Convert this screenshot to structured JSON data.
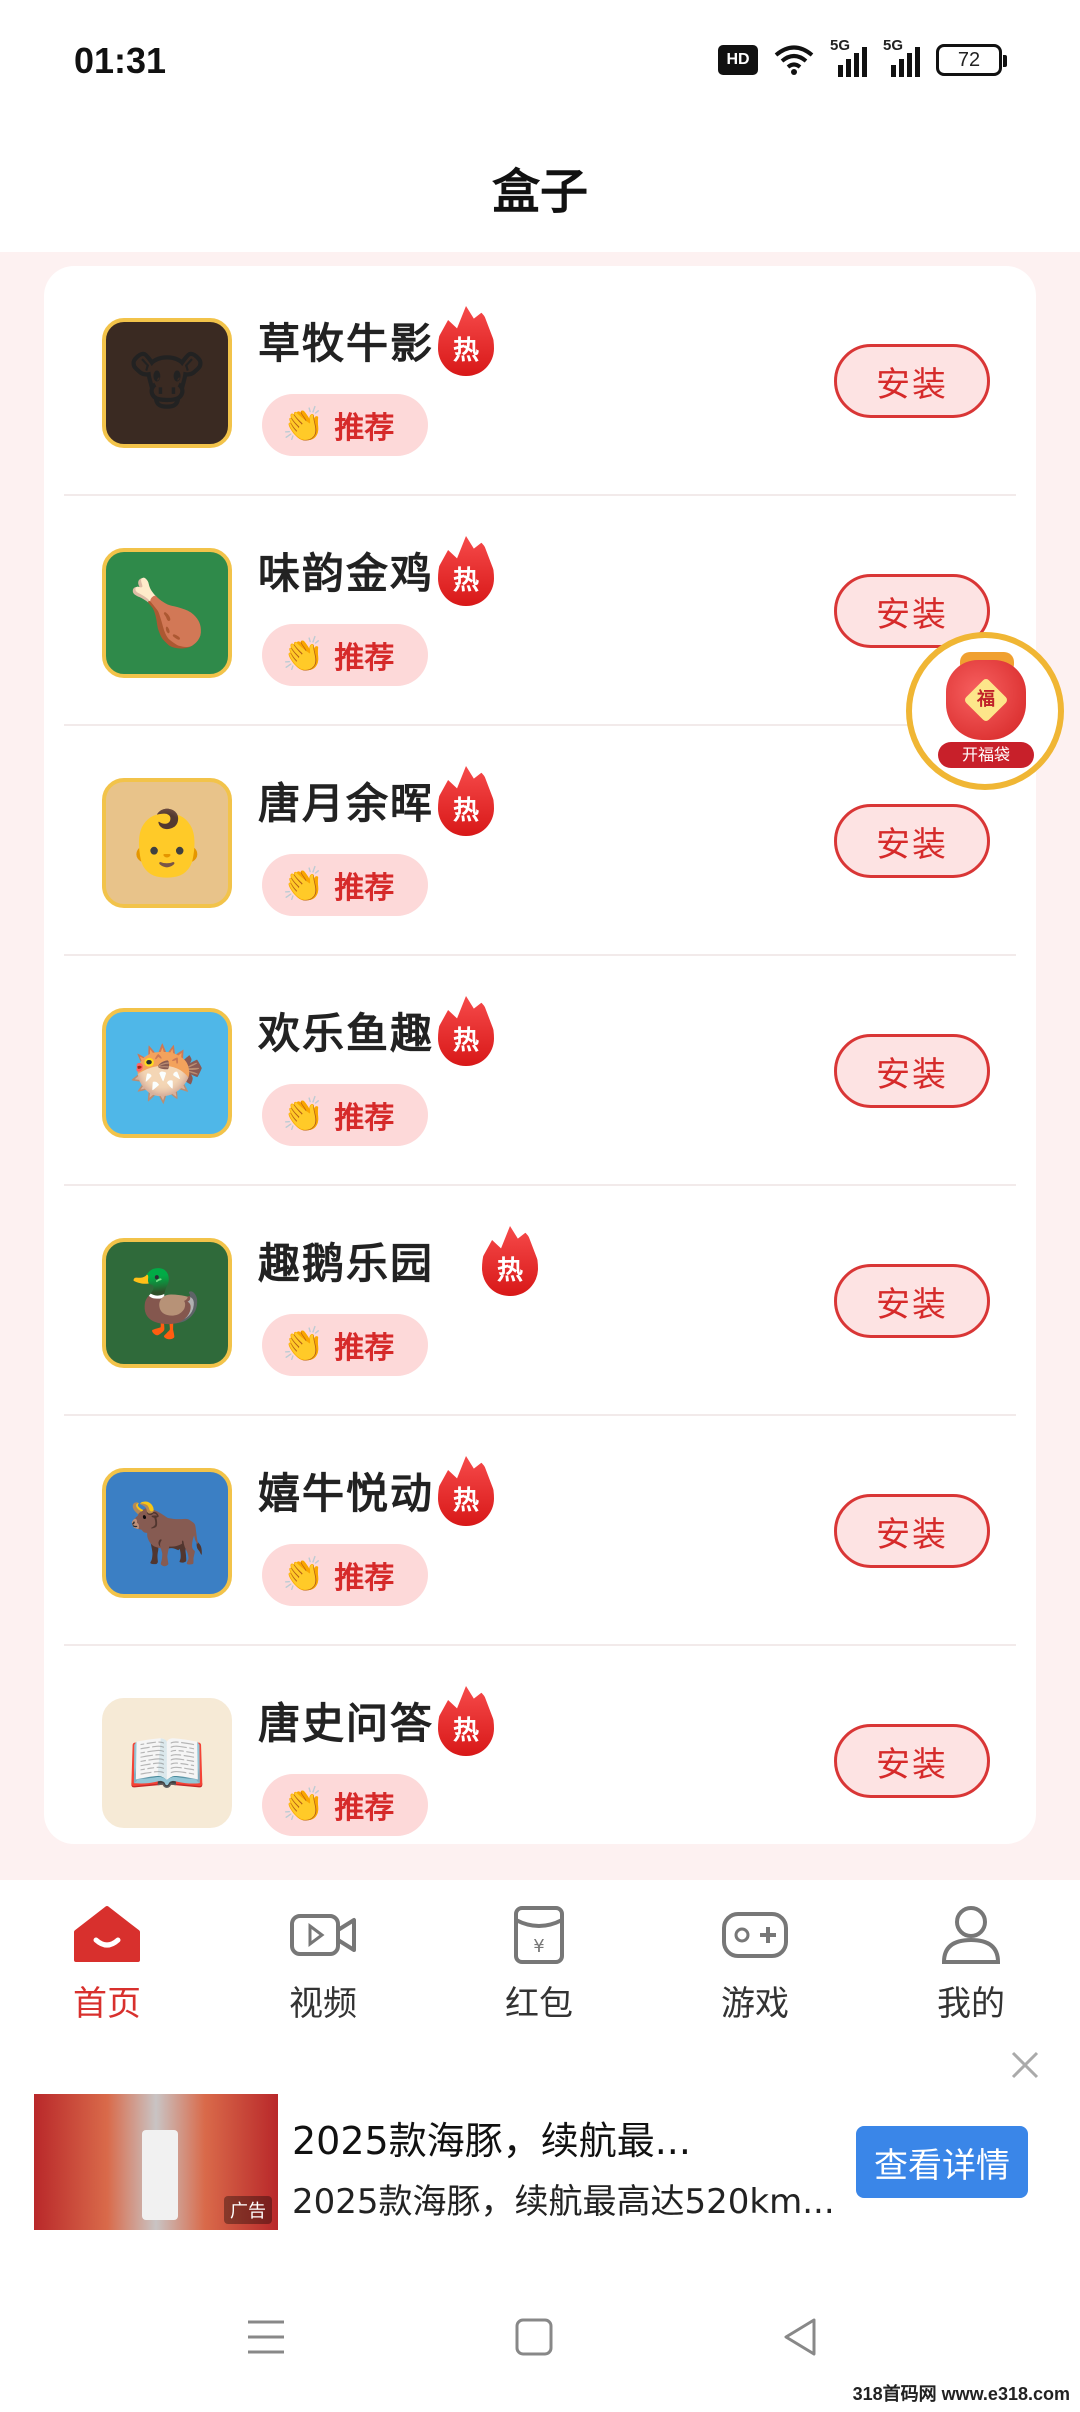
{
  "status_bar": {
    "time": "01:31",
    "hd": "HD",
    "signal1": "5G",
    "signal2": "5G",
    "battery": "72"
  },
  "header": {
    "title": "盒子"
  },
  "apps": [
    {
      "name": "草牧牛影",
      "hot": "热",
      "tag": "推荐",
      "install": "安装",
      "icon": "cow-icon",
      "icon_bg": "#3a2a22",
      "glyph": "🐮"
    },
    {
      "name": "味韵金鸡",
      "hot": "热",
      "tag": "推荐",
      "install": "安装",
      "icon": "roast-chicken-icon",
      "icon_bg": "#2f8a4a",
      "glyph": "🍗"
    },
    {
      "name": "唐月余晖",
      "hot": "热",
      "tag": "推荐",
      "install": "安装",
      "icon": "tang-child-icon",
      "icon_bg": "#e8c38a",
      "glyph": "👶"
    },
    {
      "name": "欢乐鱼趣",
      "hot": "热",
      "tag": "推荐",
      "install": "安装",
      "icon": "fish-icon",
      "icon_bg": "#4fb7e8",
      "glyph": "🐡"
    },
    {
      "name": "趣鹅乐园",
      "hot": "热",
      "tag": "推荐",
      "install": "安装",
      "icon": "roast-goose-icon",
      "icon_bg": "#2f6a3a",
      "glyph": "🦆"
    },
    {
      "name": "嬉牛悦动",
      "hot": "热",
      "tag": "推荐",
      "install": "安装",
      "icon": "bull-icon",
      "icon_bg": "#3b7fc4",
      "glyph": "🐂"
    },
    {
      "name": "唐史问答",
      "hot": "热",
      "tag": "推荐",
      "install": "安装",
      "icon": "book-quiz-icon",
      "icon_bg": "#f6ead6",
      "glyph": "📖"
    }
  ],
  "floating": {
    "fu": "福",
    "label": "开福袋"
  },
  "nav": {
    "home": "首页",
    "video": "视频",
    "redpacket": "红包",
    "game": "游戏",
    "mine": "我的",
    "active_color": "#d8302d"
  },
  "ad": {
    "title": "2025款海豚，续航最...",
    "subtitle": "2025款海豚，续航最高达520km...",
    "cta": "查看详情",
    "tag": "广告"
  },
  "watermark": "318首码网 www.e318.com"
}
